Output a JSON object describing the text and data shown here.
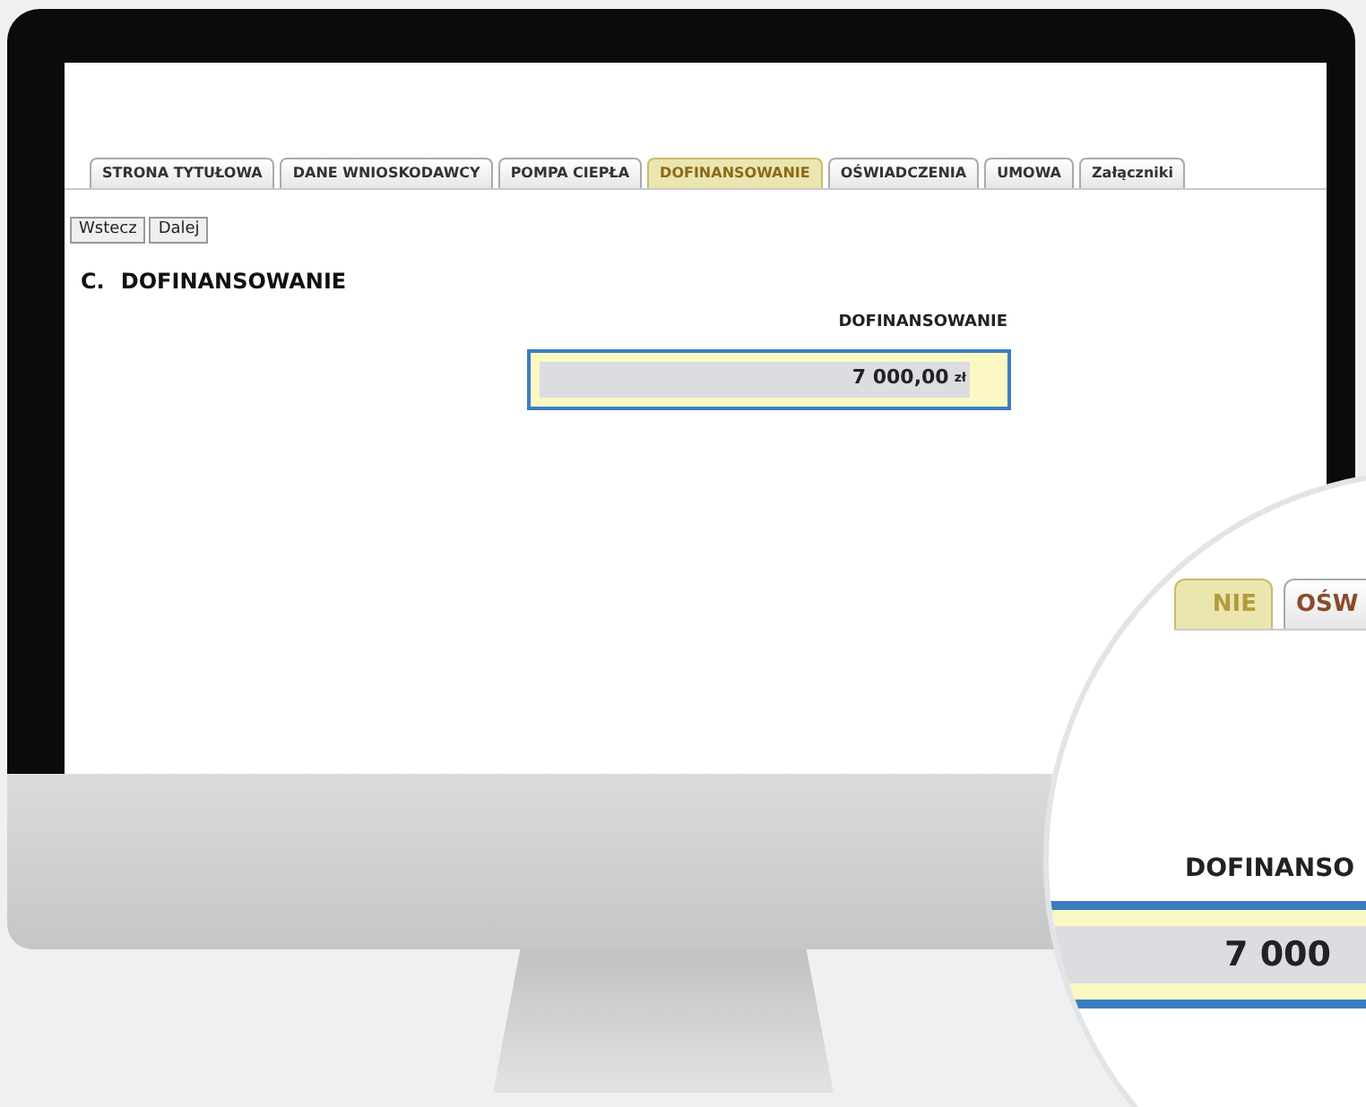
{
  "tabs": [
    {
      "label": "STRONA TYTUŁOWA",
      "selected": false
    },
    {
      "label": "DANE WNIOSKODAWCY",
      "selected": false
    },
    {
      "label": "POMPA CIEPŁA",
      "selected": false
    },
    {
      "label": "DOFINANSOWANIE",
      "selected": true
    },
    {
      "label": "OŚWIADCZENIA",
      "selected": false
    },
    {
      "label": "UMOWA",
      "selected": false
    },
    {
      "label": "Załączniki",
      "selected": false
    }
  ],
  "buttons": [
    "Wstecz",
    "Dalej"
  ],
  "heading": {
    "letter": "C.",
    "title": "DOFINANSOWANIE"
  },
  "field": {
    "label": "DOFINANSOWANIE",
    "value": "7 000,00",
    "unit": "zł"
  },
  "magnifier": {
    "tabs": [
      {
        "label": "NIE",
        "selected": true
      },
      {
        "label": "OŚW",
        "selected": false
      }
    ],
    "label": "DOFINANSO",
    "value": "7 000"
  }
}
